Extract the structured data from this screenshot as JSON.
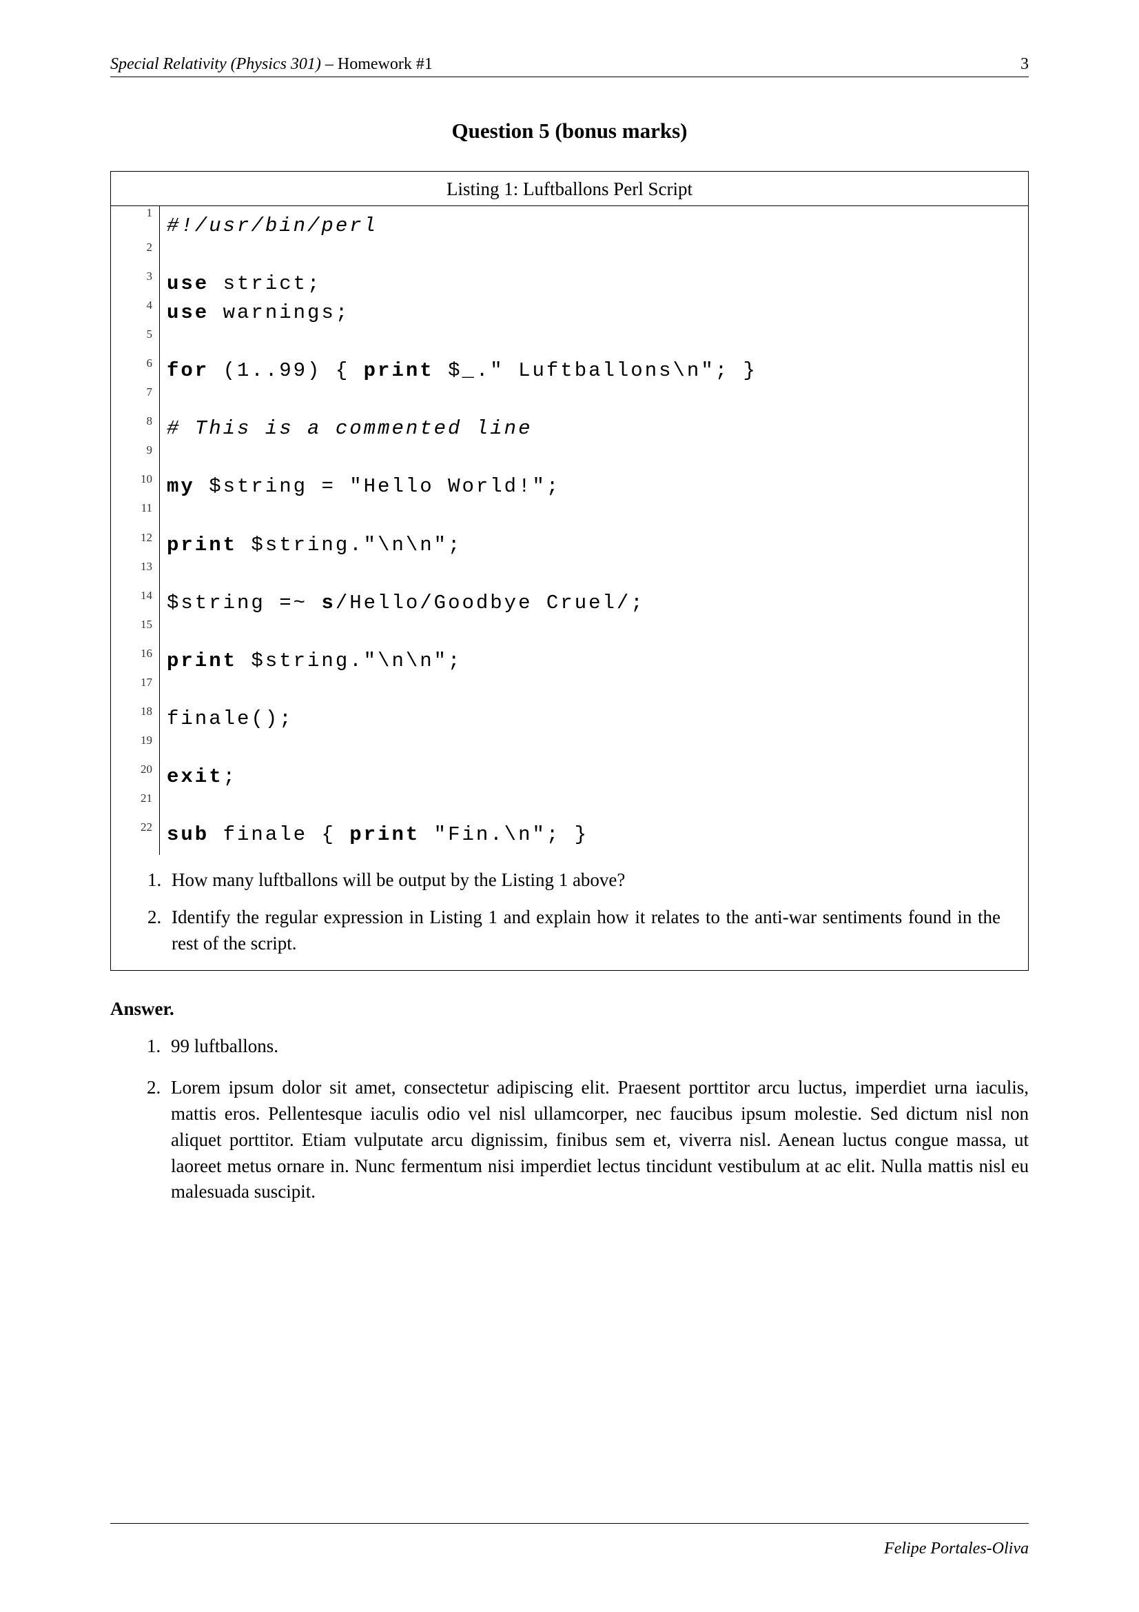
{
  "header": {
    "course": "Special Relativity (Physics 301)",
    "separator": " – ",
    "assignment": "Homework #1",
    "page_number": "3"
  },
  "question_title": "Question 5 (bonus marks)",
  "listing": {
    "caption": "Listing 1: Luftballons Perl Script",
    "lines": [
      {
        "n": "1",
        "segs": [
          {
            "t": "#!/usr/bin/perl",
            "cls": "code-comment"
          }
        ]
      },
      {
        "n": "2",
        "segs": [
          {
            "t": " ",
            "cls": ""
          }
        ]
      },
      {
        "n": "3",
        "segs": [
          {
            "t": "use",
            "cls": "code-keyword"
          },
          {
            "t": " strict;",
            "cls": ""
          }
        ]
      },
      {
        "n": "4",
        "segs": [
          {
            "t": "use",
            "cls": "code-keyword"
          },
          {
            "t": " warnings;",
            "cls": ""
          }
        ]
      },
      {
        "n": "5",
        "segs": [
          {
            "t": " ",
            "cls": ""
          }
        ]
      },
      {
        "n": "6",
        "segs": [
          {
            "t": "for",
            "cls": "code-keyword"
          },
          {
            "t": " (1..99) { ",
            "cls": ""
          },
          {
            "t": "print",
            "cls": "code-keyword"
          },
          {
            "t": " $_.\" Luftballons\\n\"; }",
            "cls": ""
          }
        ]
      },
      {
        "n": "7",
        "segs": [
          {
            "t": " ",
            "cls": ""
          }
        ]
      },
      {
        "n": "8",
        "segs": [
          {
            "t": "# This is a commented line",
            "cls": "code-comment"
          }
        ]
      },
      {
        "n": "9",
        "segs": [
          {
            "t": " ",
            "cls": ""
          }
        ]
      },
      {
        "n": "10",
        "segs": [
          {
            "t": "my",
            "cls": "code-keyword"
          },
          {
            "t": " $string = \"Hello World!\";",
            "cls": ""
          }
        ]
      },
      {
        "n": "11",
        "segs": [
          {
            "t": " ",
            "cls": ""
          }
        ]
      },
      {
        "n": "12",
        "segs": [
          {
            "t": "print",
            "cls": "code-keyword"
          },
          {
            "t": " $string.\"\\n\\n\";",
            "cls": ""
          }
        ]
      },
      {
        "n": "13",
        "segs": [
          {
            "t": " ",
            "cls": ""
          }
        ]
      },
      {
        "n": "14",
        "segs": [
          {
            "t": "$string =~ ",
            "cls": ""
          },
          {
            "t": "s",
            "cls": "code-keyword"
          },
          {
            "t": "/Hello/Goodbye Cruel/;",
            "cls": ""
          }
        ]
      },
      {
        "n": "15",
        "segs": [
          {
            "t": " ",
            "cls": ""
          }
        ]
      },
      {
        "n": "16",
        "segs": [
          {
            "t": "print",
            "cls": "code-keyword"
          },
          {
            "t": " $string.\"\\n\\n\";",
            "cls": ""
          }
        ]
      },
      {
        "n": "17",
        "segs": [
          {
            "t": " ",
            "cls": ""
          }
        ]
      },
      {
        "n": "18",
        "segs": [
          {
            "t": "finale();",
            "cls": ""
          }
        ]
      },
      {
        "n": "19",
        "segs": [
          {
            "t": " ",
            "cls": ""
          }
        ]
      },
      {
        "n": "20",
        "segs": [
          {
            "t": "exit",
            "cls": "code-keyword"
          },
          {
            "t": ";",
            "cls": ""
          }
        ]
      },
      {
        "n": "21",
        "segs": [
          {
            "t": " ",
            "cls": ""
          }
        ]
      },
      {
        "n": "22",
        "segs": [
          {
            "t": "sub",
            "cls": "code-keyword"
          },
          {
            "t": " finale { ",
            "cls": ""
          },
          {
            "t": "print",
            "cls": "code-keyword"
          },
          {
            "t": " \"Fin.\\n\"; }",
            "cls": ""
          }
        ]
      }
    ]
  },
  "questions": [
    "How many luftballons will be output by the Listing 1 above?",
    "Identify the regular expression in Listing 1 and explain how it relates to the anti-war sentiments found in the rest of the script."
  ],
  "answer_heading": "Answer.",
  "answers": [
    "99 luftballons.",
    "Lorem ipsum dolor sit amet, consectetur adipiscing elit. Praesent porttitor arcu luctus, imperdiet urna iaculis, mattis eros. Pellentesque iaculis odio vel nisl ullamcorper, nec faucibus ipsum molestie. Sed dictum nisl non aliquet porttitor. Etiam vulputate arcu dignissim, finibus sem et, viverra nisl. Aenean luctus congue massa, ut laoreet metus ornare in. Nunc fermentum nisi imperdiet lectus tincidunt vestibulum at ac elit. Nulla mattis nisl eu malesuada suscipit."
  ],
  "footer": {
    "author": "Felipe Portales-Oliva"
  }
}
